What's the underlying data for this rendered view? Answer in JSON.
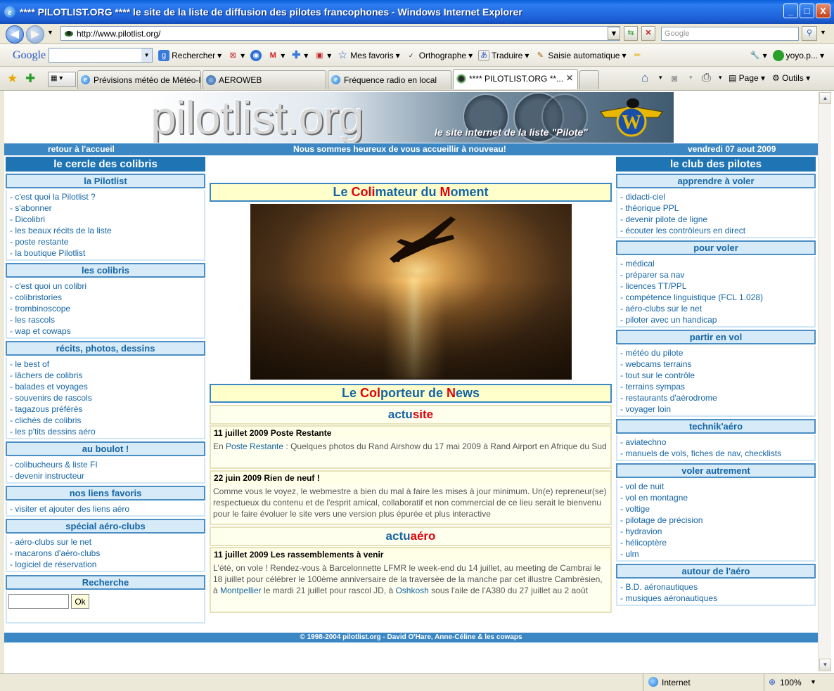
{
  "window": {
    "title": "**** PILOTLIST.ORG **** le site de la liste de diffusion des pilotes francophones - Windows Internet Explorer",
    "min": "_",
    "max": "□",
    "close": "X"
  },
  "address": {
    "url": "http://www.pilotlist.org/",
    "search_placeholder": "Google"
  },
  "google_toolbar": {
    "logo": "Google",
    "rechercher": "Rechercher",
    "mes_favoris": "Mes favoris",
    "orthographe": "Orthographe",
    "traduire": "Traduire",
    "saisie": "Saisie automatique",
    "user": "yoyo.p..."
  },
  "tabs": [
    {
      "label": "Prévisions météo de Météo-F..."
    },
    {
      "label": "AEROWEB"
    },
    {
      "label": "Fréquence radio en local"
    },
    {
      "label": "**** PILOTLIST.ORG **..."
    }
  ],
  "tab_tools": {
    "page": "Page",
    "outils": "Outils"
  },
  "banner": {
    "logo": "pilotlist.org",
    "subtitle": "le site internet de la liste \"Pilote\""
  },
  "nav": {
    "home": "retour à l'accueil",
    "welcome": "Nous sommes heureux de vous accueillir à nouveau!",
    "date": "vendredi 07 aout 2009"
  },
  "left": {
    "title": "le cercle des colibris",
    "sections": [
      {
        "title": "la Pilotlist",
        "items": [
          "- c'est quoi la Pilotlist ?",
          "- s'abonner",
          "- Dicolibri",
          "- les beaux récits de la liste",
          "- poste restante",
          "- la boutique Pilotlist"
        ]
      },
      {
        "title": "les colibris",
        "items": [
          "- c'est quoi un colibri",
          "- colibristories",
          "- trombinoscope",
          "- les rascols",
          "- wap et cowaps"
        ]
      },
      {
        "title": "récits, photos, dessins",
        "items": [
          "- le best of",
          "- lâchers de colibris",
          "- balades et voyages",
          "- souvenirs de rascols",
          "- tagazous préférés",
          "- clichés de colibris",
          "- les p'tits dessins aéro"
        ]
      },
      {
        "title": "au boulot !",
        "items": [
          "- colibucheurs & liste FI",
          "- devenir instructeur"
        ]
      },
      {
        "title": "nos liens favoris",
        "items": [
          "- visiter et ajouter des liens aéro"
        ]
      },
      {
        "title": "spécial aéro-clubs",
        "items": [
          "- aéro-clubs sur le net",
          "- macarons d'aéro-clubs",
          "- logiciel de réservation"
        ]
      }
    ],
    "search_title": "Recherche",
    "search_button": "Ok"
  },
  "right": {
    "title": "le club des pilotes",
    "sections": [
      {
        "title": "apprendre à voler",
        "items": [
          "- didacti-ciel",
          "- théorique PPL",
          "- devenir pilote de ligne",
          "- écouter les contrôleurs en direct"
        ]
      },
      {
        "title": "pour voler",
        "items": [
          "- médical",
          "- préparer sa nav",
          "- licences TT/PPL",
          "- compétence linguistique (FCL 1.028)",
          "- aéro-clubs sur le net",
          "- piloter avec un handicap"
        ]
      },
      {
        "title": "partir en vol",
        "items": [
          "- météo du pilote",
          "- webcams terrains",
          "- tout sur le contrôle",
          "- terrains sympas",
          "- restaurants d'aérodrome",
          "- voyager loin"
        ]
      },
      {
        "title": "technik'aéro",
        "items": [
          "- aviatechno",
          "- manuels de vols, fiches de nav, checklists"
        ]
      },
      {
        "title": "voler autrement",
        "items": [
          "- vol de nuit",
          "- vol en montagne",
          "- voltige",
          "- pilotage de précision",
          "- hydravion",
          "- hélicoptère",
          "- ulm"
        ]
      },
      {
        "title": "autour de l'aéro",
        "items": [
          "- B.D. aéronautiques",
          "- musiques aéronautiques"
        ]
      }
    ]
  },
  "center": {
    "colimateur": {
      "p1": "Le ",
      "p2": "Coli",
      "p3": "mateur du ",
      "p4": "M",
      "p5": "oment"
    },
    "colporteur": {
      "p1": "Le ",
      "p2": "Col",
      "p3": "porteur de ",
      "p4": "N",
      "p5": "ews"
    },
    "actusite": {
      "a": "actu",
      "b": "site"
    },
    "actuaero": {
      "a": "actu",
      "b": "aéro"
    },
    "news1": {
      "head": "11 juillet 2009 Poste Restante",
      "pre": "En ",
      "link": "Poste Restante",
      "post": " : Quelques photos du Rand Airshow du 17 mai 2009 à Rand Airport en Afrique du Sud"
    },
    "news2": {
      "head": "22 juin 2009 Rien de neuf !",
      "body": "Comme vous le voyez, le webmestre a bien du mal à faire les mises à jour minimum. Un(e) repreneur(se) respectueux du contenu et de l'esprit amical, collaboratif et non commercial de ce lieu serait le bienvenu pour le faire évoluer le site vers une version plus épurée et plus interactive"
    },
    "news3": {
      "head": "11 juillet 2009 Les rassemblements à venir",
      "t1": "L'été, on vole ! Rendez-vous à Barcelonnette LFMR le week-end du 14 juillet, au meeting de Cambrai le 18 juillet pour célébrer le 100ème anniversaire de la traversée de la manche par cet illustre Cambrésien, à ",
      "l1": "Montpellier",
      "t2": " le mardi 21 juillet pour rascol JD, à ",
      "l2": "Oshkosh",
      "t3": " sous l'aile de l'A380 du 27 juillet au 2 août"
    }
  },
  "footer": "© 1998-2004 pilotlist.org - David O'Hare, Anne-Céline & les cowaps",
  "status": {
    "zone": "Internet",
    "zoom": "100%"
  }
}
